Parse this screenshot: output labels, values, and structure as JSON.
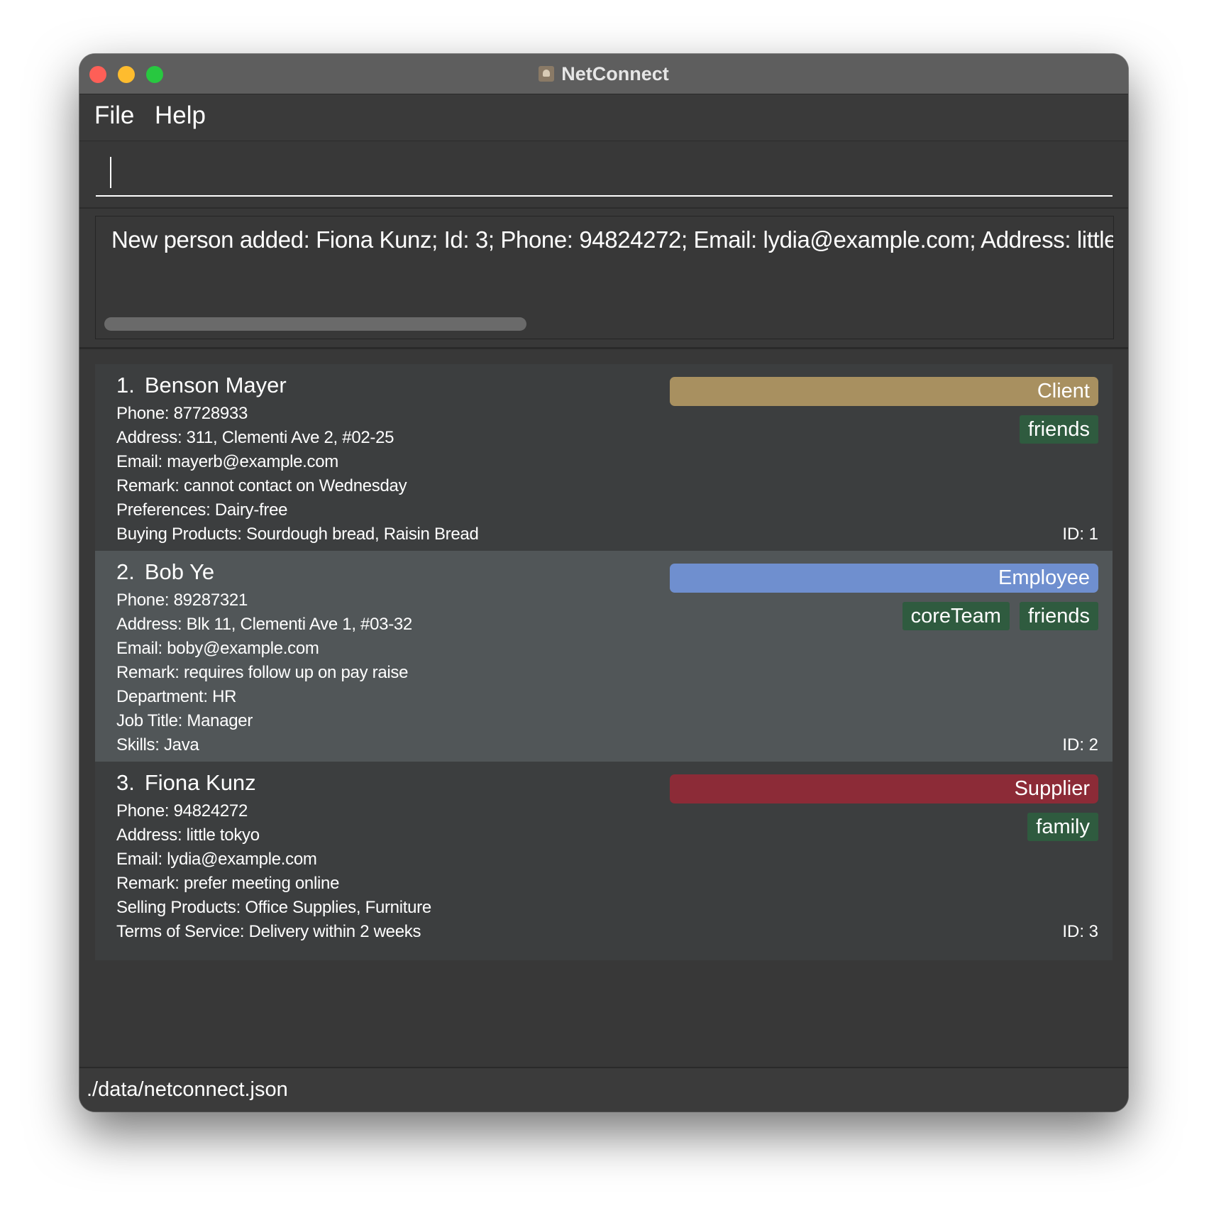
{
  "window": {
    "title": "NetConnect"
  },
  "menu": {
    "file": "File",
    "help": "Help"
  },
  "command": {
    "value": ""
  },
  "result": {
    "text": "New person added: Fiona Kunz; Id: 3; Phone: 94824272; Email: lydia@example.com; Address: little tokyo"
  },
  "persons": [
    {
      "index": "1.",
      "name": "Benson Mayer",
      "role": "Client",
      "role_color": "#a89060",
      "tags": [
        "friends"
      ],
      "details": [
        "Phone: 87728933",
        "Address: 311, Clementi Ave 2, #02-25",
        "Email: mayerb@example.com",
        "Remark: cannot contact on Wednesday",
        "Preferences: Dairy-free",
        "Buying Products: Sourdough bread, Raisin Bread"
      ],
      "id": "ID: 1"
    },
    {
      "index": "2.",
      "name": "Bob Ye",
      "role": "Employee",
      "role_color": "#6f8fcf",
      "tags": [
        "coreTeam",
        "friends"
      ],
      "details": [
        "Phone: 89287321",
        "Address: Blk 11, Clementi Ave 1, #03-32",
        "Email: boby@example.com",
        "Remark: requires follow up on pay raise",
        "Department: HR",
        "Job Title: Manager",
        "Skills: Java"
      ],
      "id": "ID: 2"
    },
    {
      "index": "3.",
      "name": "Fiona Kunz",
      "role": "Supplier",
      "role_color": "#8c2b37",
      "tags": [
        "family"
      ],
      "details": [
        "Phone: 94824272",
        "Address: little tokyo",
        "Email: lydia@example.com",
        "Remark: prefer meeting online",
        "Selling Products: Office Supplies, Furniture",
        "Terms of Service: Delivery within 2 weeks"
      ],
      "id": "ID: 3"
    }
  ],
  "status": {
    "path": "./data/netconnect.json"
  }
}
